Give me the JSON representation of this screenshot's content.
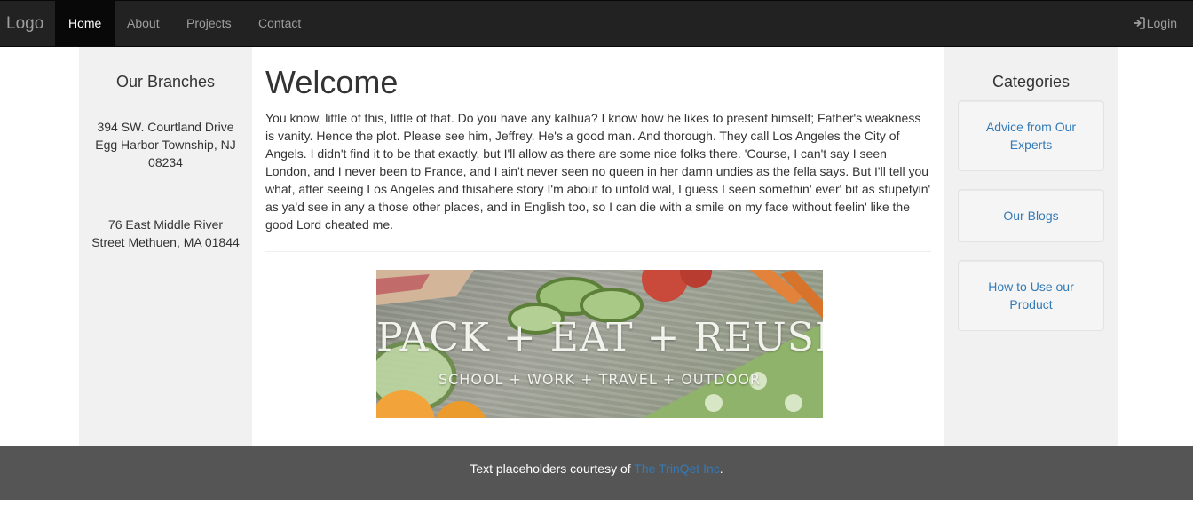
{
  "navbar": {
    "brand": "Logo",
    "links": [
      "Home",
      "About",
      "Projects",
      "Contact"
    ],
    "active": "Home",
    "login_label": "Login",
    "login_icon": "log-in-icon"
  },
  "left_sidebar": {
    "title": "Our Branches",
    "branches": [
      "394 SW. Courtland Drive Egg Harbor Township, NJ 08234",
      "76 East Middle River Street Methuen, MA 01844"
    ]
  },
  "main": {
    "heading": "Welcome",
    "intro": "You know, little of this, little of that. Do you have any kalhua? I know how he likes to present himself; Father's weakness is vanity. Hence the plot. Please see him, Jeffrey. He's a good man. And thorough. They call Los Angeles the City of Angels. I didn't find it to be that exactly, but I'll allow as there are some nice folks there. 'Course, I can't say I seen London, and I never been to France, and I ain't never seen no queen in her damn undies as the fella says. But I'll tell you what, after seeing Los Angeles and thisahere story I'm about to unfold wal, I guess I seen somethin' ever' bit as stupefyin' as ya'd see in any a those other places, and in English too, so I can die with a smile on my face without feelin' like the good Lord cheated me.",
    "banner": {
      "headline": "PACK + EAT + REUSE",
      "subline": "SCHOOL + WORK + TRAVEL + OUTDOOR"
    }
  },
  "right_sidebar": {
    "title": "Categories",
    "items": [
      "Advice from Our Experts",
      "Our Blogs",
      "How to Use our Product"
    ]
  },
  "footer": {
    "text": "Text placeholders courtesy of ",
    "link": "The TrinQet Inc",
    "suffix": "."
  },
  "colors": {
    "navbar_bg": "#222222",
    "sidebar_bg": "#f1f1f1",
    "footer_bg": "#555555",
    "link": "#337ab7"
  }
}
